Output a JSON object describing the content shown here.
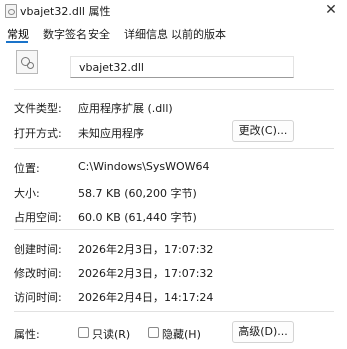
{
  "window": {
    "title": "vbajet32.dll 属性",
    "close_glyph": "✕"
  },
  "tabs": [
    {
      "label": "常规",
      "active": true
    },
    {
      "label": "数字签名"
    },
    {
      "label": "安全"
    },
    {
      "label": "详细信息"
    },
    {
      "label": "以前的版本"
    }
  ],
  "file": {
    "name": "vbajet32.dll",
    "icon": "dll-file-icon"
  },
  "rows": {
    "type": {
      "label": "文件类型:",
      "value": "应用程序扩展 (.dll)"
    },
    "opens_with": {
      "label": "打开方式:",
      "value": "未知应用程序",
      "button": "更改(C)..."
    },
    "location": {
      "label": "位置:",
      "value": "C:\\Windows\\SysWOW64"
    },
    "size": {
      "label": "大小:",
      "value": "58.7 KB (60,200 字节)"
    },
    "size_on_disk": {
      "label": "占用空间:",
      "value": "60.0 KB (61,440 字节)"
    },
    "created": {
      "label": "创建时间:",
      "value": "2026年2月3日，17:07:32"
    },
    "modified": {
      "label": "修改时间:",
      "value": "2026年2月3日，17:07:32"
    },
    "accessed": {
      "label": "访问时间:",
      "value": "2026年2月4日，14:17:24"
    },
    "attributes": {
      "label": "属性:",
      "readonly": {
        "label": "只读(R)",
        "checked": false
      },
      "hidden": {
        "label": "隐藏(H)",
        "checked": false
      },
      "advanced_button": "高级(D)..."
    }
  },
  "colors": {
    "accent": "#1a73c9"
  }
}
